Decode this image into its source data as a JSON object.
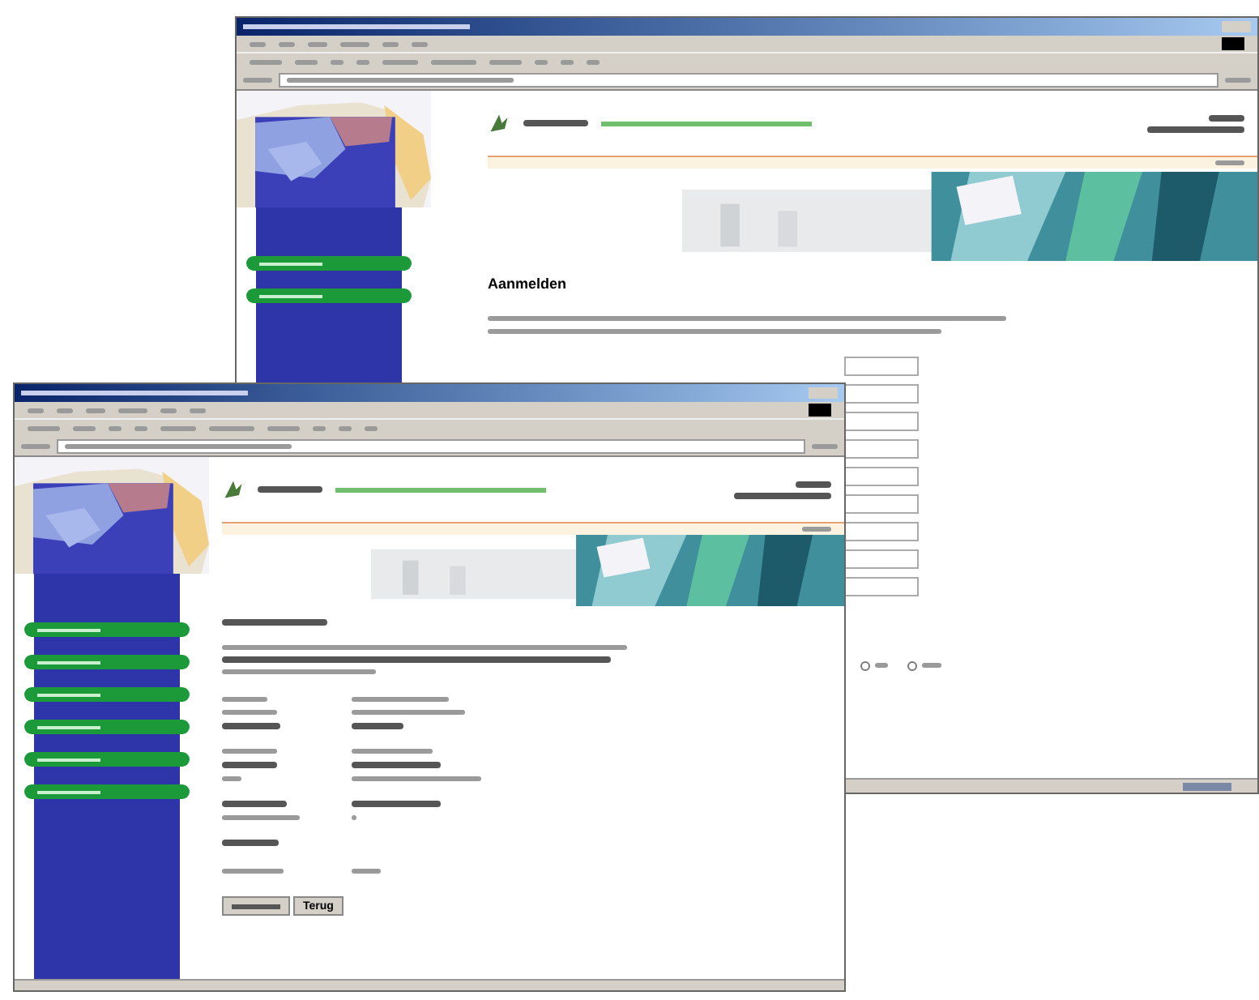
{
  "back_window": {
    "heading": "Aanmelden",
    "nav_items": [
      {
        "selected": false
      },
      {
        "selected": false
      }
    ],
    "options": [
      {
        "selected": false
      },
      {
        "selected": false
      }
    ]
  },
  "front_window": {
    "nav_items": [
      {
        "selected": false
      },
      {
        "selected": false
      },
      {
        "selected": false
      },
      {
        "selected": false
      },
      {
        "selected": false
      },
      {
        "selected": false
      }
    ],
    "buttons": [
      {
        "kind": "blurred"
      },
      {
        "kind": "text",
        "label": "Terug"
      }
    ]
  }
}
